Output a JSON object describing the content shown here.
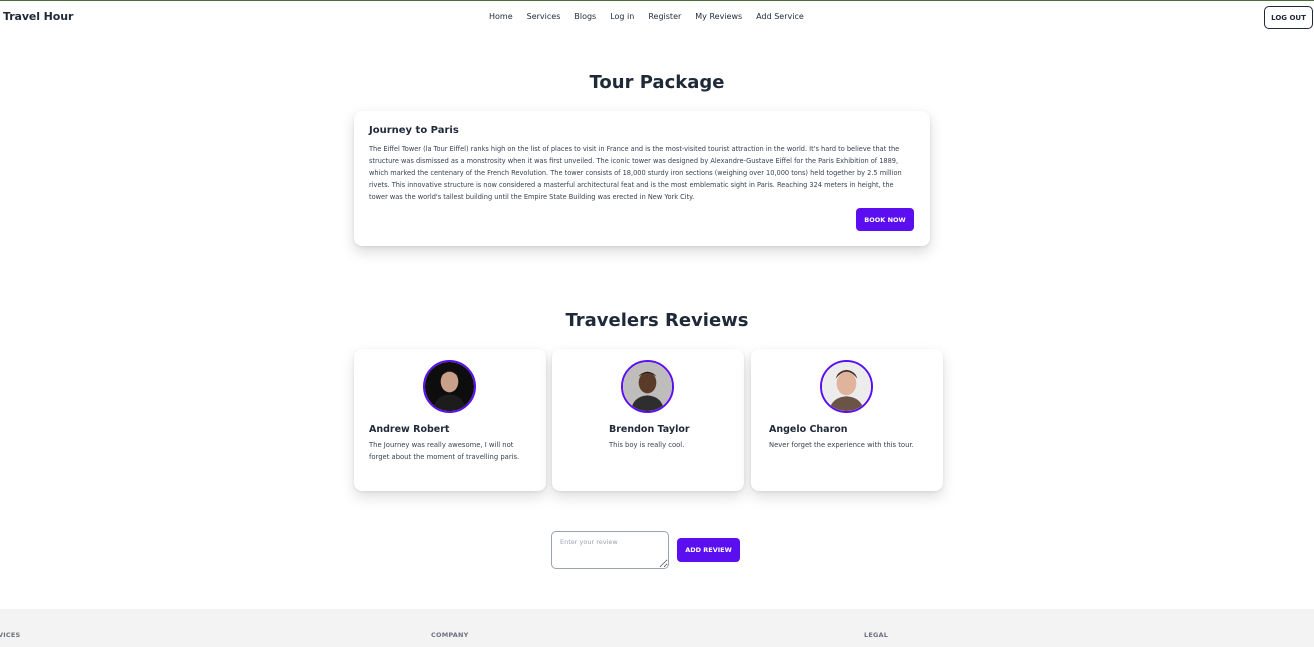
{
  "header": {
    "brand": "Travel Hour",
    "nav": [
      "Home",
      "Services",
      "Blogs",
      "Log in",
      "Register",
      "My Reviews",
      "Add Service"
    ],
    "logout_label": "LOG OUT"
  },
  "package": {
    "section_title": "Tour Package",
    "title": "Journey to Paris",
    "description": "The Eiffel Tower (la Tour Eiffel) ranks high on the list of places to visit in France and is the most-visited tourist attraction in the world. It's hard to believe that the structure was dismissed as a monstrosity when it was first unveiled. The iconic tower was designed by Alexandre-Gustave Eiffel for the Paris Exhibition of 1889, which marked the centenary of the French Revolution. The tower consists of 18,000 sturdy iron sections (weighing over 10,000 tons) held together by 2.5 million rivets. This innovative structure is now considered a masterful architectural feat and is the most emblematic sight in Paris. Reaching 324 meters in height, the tower was the world's tallest building until the Empire State Building was erected in New York City.",
    "book_label": "BOOK NOW"
  },
  "reviews": {
    "section_title": "Travelers Reviews",
    "items": [
      {
        "name": "Andrew Robert",
        "text": "The Journey was really awesome, I will not forget about the moment of travelling paris."
      },
      {
        "name": "Brendon Taylor",
        "text": "This boy is really cool."
      },
      {
        "name": "Angelo Charon",
        "text": "Never forget the experience with this tour."
      }
    ],
    "input_placeholder": "Enter your review",
    "add_label": "ADD REVIEW"
  },
  "footer": {
    "headings": [
      "VICES",
      "COMPANY",
      "LEGAL"
    ]
  },
  "colors": {
    "accent": "#5b0ef0",
    "text": "#1f2937",
    "footer_bg": "#f3f3f3"
  }
}
